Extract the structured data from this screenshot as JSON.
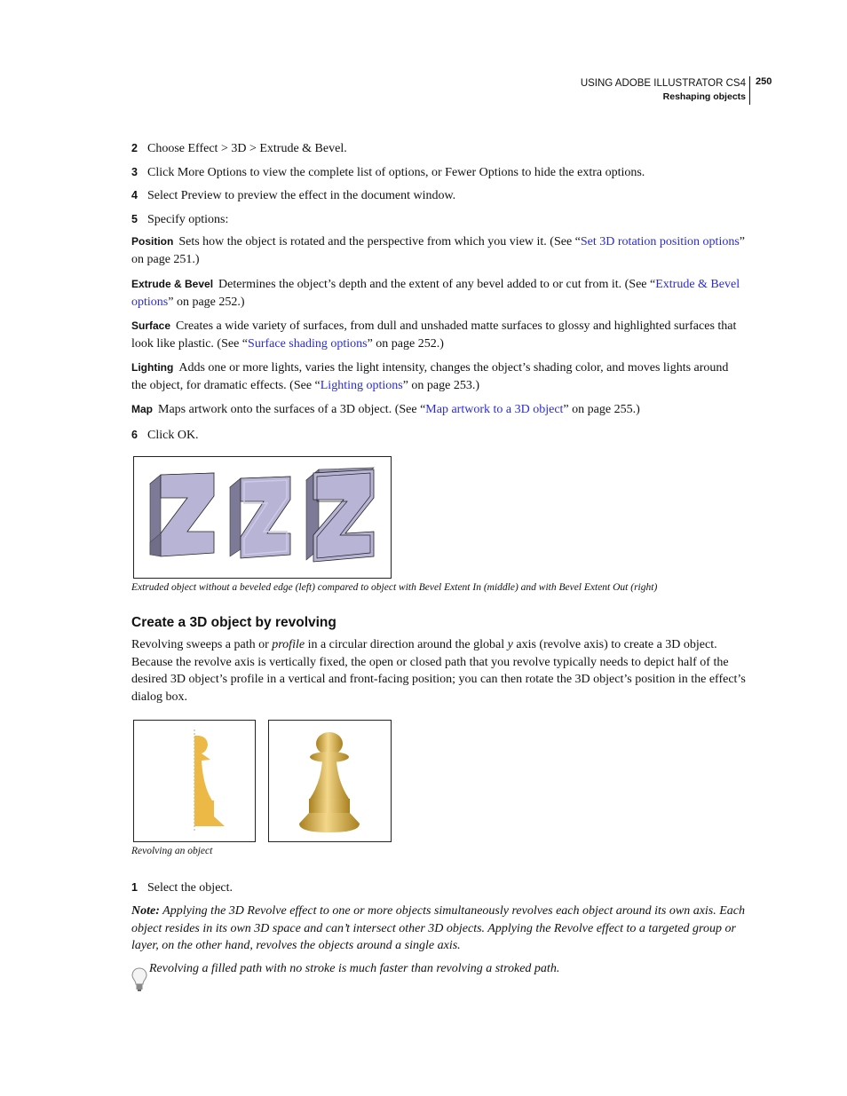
{
  "header": {
    "book_title": "USING ADOBE ILLUSTRATOR CS4",
    "chapter": "Reshaping objects",
    "page_number": "250"
  },
  "steps_top": [
    {
      "num": "2",
      "text": "Choose Effect > 3D > Extrude & Bevel."
    },
    {
      "num": "3",
      "text": "Click More Options to view the complete list of options, or Fewer Options to hide the extra options."
    },
    {
      "num": "4",
      "text": "Select Preview to preview the effect in the document window."
    },
    {
      "num": "5",
      "text": "Specify options:"
    }
  ],
  "options": [
    {
      "term": "Position",
      "text": "Sets how the object is rotated and the perspective from which you view it. (See “",
      "link": "Set 3D rotation position options",
      "after": "” on page 251.)"
    },
    {
      "term": "Extrude & Bevel",
      "text": "Determines the object’s depth and the extent of any bevel added to or cut from it. (See “",
      "link": "Extrude & Bevel options",
      "after": "” on page 252.)"
    },
    {
      "term": "Surface",
      "text": "Creates a wide variety of surfaces, from dull and unshaded matte surfaces to glossy and highlighted surfaces that look like plastic. (See “",
      "link": "Surface shading options",
      "after": "” on page 252.)"
    },
    {
      "term": "Lighting",
      "text": "Adds one or more lights, varies the light intensity, changes the object’s shading color, and moves lights around the object, for dramatic effects. (See “",
      "link": "Lighting options",
      "after": "” on page 253.)"
    },
    {
      "term": "Map",
      "text": "Maps artwork onto the surfaces of a 3D object. (See “",
      "link": "Map artwork to a 3D object",
      "after": "” on page 255.)"
    }
  ],
  "step6": {
    "num": "6",
    "text": "Click OK."
  },
  "figure1": {
    "caption": "Extruded object without a beveled edge (left) compared to object with Bevel Extent In (middle) and with Bevel Extent Out (right)",
    "colors": {
      "face": "#b8b4d6",
      "side": "#7c7a96",
      "top": "#9996b4"
    }
  },
  "section": {
    "heading": "Create a 3D object by revolving",
    "para_1": "Revolving sweeps a path or ",
    "para_em1": "profile",
    "para_2": " in a circular direction around the global ",
    "para_em2": "y",
    "para_3": " axis (revolve axis) to create a 3D object. Because the revolve axis is vertically fixed, the open or closed path that you revolve typically needs to depict half of the desired 3D object’s profile in a vertical and front-facing position; you can then rotate the 3D object’s position in the effect’s dialog box."
  },
  "figure2": {
    "caption": "Revolving an object",
    "colors": {
      "profile": "#ecb947",
      "pawn_light": "#f3d78a",
      "pawn_dark": "#a8801f"
    }
  },
  "step1": {
    "num": "1",
    "text": "Select the object."
  },
  "note": {
    "label": "Note:",
    "text": " Applying the 3D Revolve effect to one or more objects simultaneously revolves each object around its own axis. Each object resides in its own 3D space and can’t intersect other 3D objects. Applying the Revolve effect to a targeted group or layer, on the other hand, revolves the objects around a single axis."
  },
  "tip": {
    "text": "Revolving a filled path with no stroke is much faster than revolving a stroked path."
  }
}
